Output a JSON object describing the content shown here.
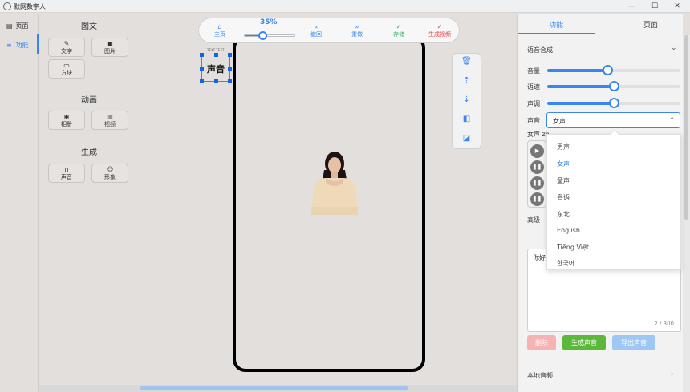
{
  "window": {
    "title": "默网数字人",
    "minimize": "—",
    "maximize": "☐",
    "close": "✕"
  },
  "leftnav": {
    "items": [
      {
        "icon": "▤",
        "label": "页面"
      },
      {
        "icon": "≡",
        "label": "功能"
      }
    ]
  },
  "tools": {
    "sections": [
      {
        "title": "图文",
        "buttons": [
          {
            "icon": "✎",
            "label": "文字"
          },
          {
            "icon": "▣",
            "label": "图片"
          },
          {
            "icon": "▭",
            "label": "方块"
          }
        ]
      },
      {
        "title": "动画",
        "buttons": [
          {
            "icon": "◉",
            "label": "相册"
          },
          {
            "icon": "▥",
            "label": "视频"
          }
        ]
      },
      {
        "title": "生成",
        "buttons": [
          {
            "icon": "∩",
            "label": "声音"
          },
          {
            "icon": "☺",
            "label": "形象"
          }
        ]
      }
    ]
  },
  "toolbar": {
    "zoom_label": "35%",
    "zoom_percent": 35,
    "home": {
      "icon": "⌂",
      "label": "主页"
    },
    "undo": {
      "icon": "«",
      "label": "撤回"
    },
    "redo": {
      "icon": "»",
      "label": "重做"
    },
    "save": {
      "icon": "✓",
      "label": "存储"
    },
    "generate": {
      "icon": "✓",
      "label": "生成视频"
    }
  },
  "canvas": {
    "text_element": {
      "label": "声音",
      "caption": "TEXT TEXT"
    }
  },
  "side_tools": {
    "delete": "🗑",
    "move_up": "⇡",
    "move_down": "⇣",
    "bring_front": "◧",
    "send_back": "◪"
  },
  "right_panel": {
    "tabs": [
      "功能",
      "页面"
    ],
    "section_title": "语音合成",
    "sliders": [
      {
        "label": "音量",
        "value": 0.45
      },
      {
        "label": "语速",
        "value": 0.5
      },
      {
        "label": "声调",
        "value": 0.5
      }
    ],
    "voice_label": "声音",
    "voice_value": "女声",
    "voice_name": "女声 zh...",
    "options": [
      "男声",
      "女声",
      "童声",
      "粤语",
      "东北",
      "English",
      "Tiếng Việt",
      "한국어"
    ],
    "selected_option": "女声",
    "advanced_label": "高级",
    "text_content": "你好",
    "counter": "2 / 300",
    "buttons": {
      "delete": "删除",
      "generate": "生成声音",
      "export": "导出声音"
    },
    "local_audio": "本地音频"
  },
  "colors": {
    "accent": "#3a86f0",
    "green": "#5cb83a",
    "red": "#e84545",
    "pink": "#f5b3b3",
    "lightblue": "#9fc7f5"
  }
}
